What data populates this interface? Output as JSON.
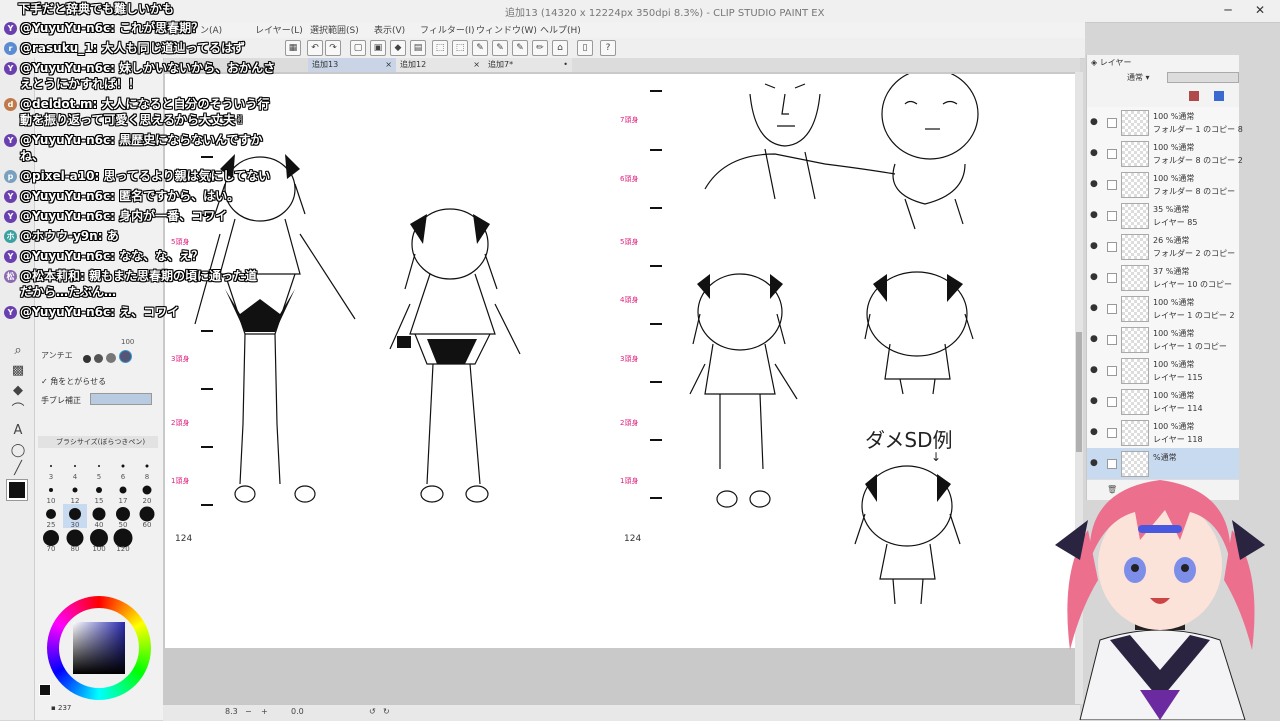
{
  "window": {
    "title": "追加13 (14320 x 12224px 350dpi 8.3%) - CLIP STUDIO PAINT EX",
    "minimize": "─",
    "close": "✕"
  },
  "menu": [
    "ン(A)",
    "レイヤー(L)",
    "選択範囲(S)",
    "表示(V)",
    "フィルター(I)",
    "ウィンドウ(W)",
    "ヘルプ(H)"
  ],
  "tabs": [
    {
      "label": "追加13",
      "close": "×"
    },
    {
      "label": "追加12",
      "close": "×"
    },
    {
      "label": "追加7*",
      "close": "•"
    }
  ],
  "chat": {
    "header": "下手だと辞典でも難しいかも",
    "messages": [
      {
        "user": "@YuyuYu-n6c",
        "text": "これが思春期？",
        "avatar": "Y"
      },
      {
        "user": "@rasuku_1",
        "text": "大人も同じ道辿ってるはず",
        "avatar": "r"
      },
      {
        "user": "@YuyuYu-n6c",
        "text": "妹しかいないから、おかんさ",
        "cont": "えとうにかすれば！！",
        "avatar": "Y"
      },
      {
        "user": "@deldot.m",
        "text": "大人になると自分のそういう行",
        "cont": "動を振り返って可愛く思えるから大丈夫✌",
        "avatar": "d"
      },
      {
        "user": "@YuyuYu-n6c",
        "text": "黒歴史にならないんですか",
        "cont": "ね、",
        "avatar": "Y"
      },
      {
        "user": "@pixel-a10",
        "text": "思ってるより親は気にしてない",
        "avatar": "p"
      },
      {
        "user": "@YuyuYu-n6c",
        "text": "匿名ですから、はい。",
        "avatar": "Y"
      },
      {
        "user": "@YuyuYu-n6c",
        "text": "身内が一番、コワイ",
        "avatar": "Y"
      },
      {
        "user": "@ホウウ-y9n",
        "text": "あ",
        "avatar": "ホ"
      },
      {
        "user": "@YuyuYu-n6c",
        "text": "なな、な、え？",
        "avatar": "Y"
      },
      {
        "user": "@松本莉和",
        "text": "親もまた思春期の頃に通った道",
        "cont": "だから…たぶん…",
        "avatar": "松"
      },
      {
        "user": "@YuyuYu-n6c",
        "text": "え、コワイ",
        "avatar": "Y"
      }
    ]
  },
  "subtool": {
    "brush_size_label": "ブラシサイズ(ぼらつきペン)",
    "anti_alias_label": "アンチエ",
    "corner_option": "角をとがらせる",
    "stabilizer_label": "手ブレ補正",
    "stabilizer_value": "100",
    "brush_sizes": [
      "3",
      "4",
      "5",
      "6",
      "8",
      "10",
      "12",
      "15",
      "17",
      "20",
      "25",
      "30",
      "40",
      "50",
      "60",
      "70",
      "80",
      "100",
      "120"
    ]
  },
  "canvas": {
    "height_labels": [
      "7頭身",
      "6頭身",
      "5頭身",
      "4頭身",
      "3頭身",
      "2頭身",
      "1頭身"
    ],
    "page_numbers": [
      "124",
      "124"
    ],
    "annotation": "ダメSD例",
    "annotation_arrow": "↓"
  },
  "layers": {
    "panel_title": "レイヤー",
    "blend_mode": "通常",
    "items": [
      {
        "opacity": "100 %通常",
        "name": "フォルダー 1 のコピー 8"
      },
      {
        "opacity": "100 %通常",
        "name": "フォルダー 8 のコピー 2"
      },
      {
        "opacity": "100 %通常",
        "name": "フォルダー 8 のコピー"
      },
      {
        "opacity": "35 %通常",
        "name": "レイヤー 85"
      },
      {
        "opacity": "26 %通常",
        "name": "フォルダー 2 のコピー"
      },
      {
        "opacity": "37 %通常",
        "name": "レイヤー 10 のコピー"
      },
      {
        "opacity": "100 %通常",
        "name": "レイヤー 1 のコピー 2"
      },
      {
        "opacity": "100 %通常",
        "name": "レイヤー 1 のコピー"
      },
      {
        "opacity": "100 %通常",
        "name": "レイヤー 115"
      },
      {
        "opacity": "100 %通常",
        "name": "レイヤー 114"
      },
      {
        "opacity": "100 %通常",
        "name": "レイヤー 118"
      },
      {
        "opacity": "%通常",
        "name": ""
      }
    ]
  },
  "status": {
    "zoom": "8.3",
    "angle": "0.0",
    "memory": "237"
  },
  "colors": {
    "accent": "#e0207e",
    "selection": "#c8daf0",
    "panel": "#f1f1f1"
  }
}
